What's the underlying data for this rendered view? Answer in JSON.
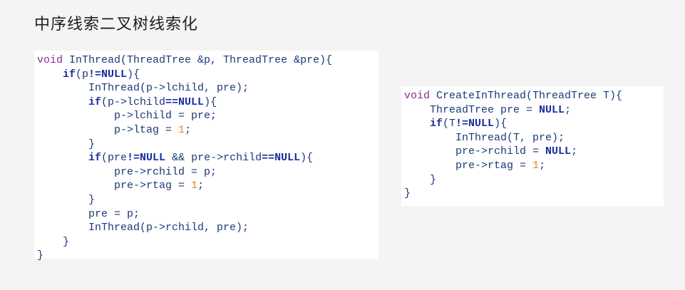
{
  "title": "中序线索二叉树线索化",
  "left_code": [
    {
      "indent": 0,
      "tokens": [
        {
          "t": "void",
          "c": "kw-void"
        },
        {
          "t": " InThread(ThreadTree &p, ThreadTree &pre){",
          "c": "plain"
        }
      ]
    },
    {
      "indent": 1,
      "tokens": [
        {
          "t": "if",
          "c": "kw-bold"
        },
        {
          "t": "(p",
          "c": "plain"
        },
        {
          "t": "!=NULL",
          "c": "kw-bold"
        },
        {
          "t": "){",
          "c": "plain"
        }
      ]
    },
    {
      "indent": 2,
      "tokens": [
        {
          "t": "InThread(p->lchild, pre);",
          "c": "plain"
        }
      ]
    },
    {
      "indent": 2,
      "tokens": [
        {
          "t": "if",
          "c": "kw-bold"
        },
        {
          "t": "(p->lchild",
          "c": "plain"
        },
        {
          "t": "==NULL",
          "c": "kw-bold"
        },
        {
          "t": "){",
          "c": "plain"
        }
      ]
    },
    {
      "indent": 3,
      "tokens": [
        {
          "t": "p->lchild = pre;",
          "c": "plain"
        }
      ]
    },
    {
      "indent": 3,
      "tokens": [
        {
          "t": "p->ltag = ",
          "c": "plain"
        },
        {
          "t": "1",
          "c": "num"
        },
        {
          "t": ";",
          "c": "plain"
        }
      ]
    },
    {
      "indent": 2,
      "tokens": [
        {
          "t": "}",
          "c": "plain"
        }
      ]
    },
    {
      "indent": 2,
      "tokens": [
        {
          "t": "if",
          "c": "kw-bold"
        },
        {
          "t": "(pre",
          "c": "plain"
        },
        {
          "t": "!=NULL",
          "c": "kw-bold"
        },
        {
          "t": " && pre->rchild",
          "c": "plain"
        },
        {
          "t": "==NULL",
          "c": "kw-bold"
        },
        {
          "t": "){",
          "c": "plain"
        }
      ]
    },
    {
      "indent": 3,
      "tokens": [
        {
          "t": "pre->rchild = p;",
          "c": "plain"
        }
      ]
    },
    {
      "indent": 3,
      "tokens": [
        {
          "t": "pre->rtag = ",
          "c": "plain"
        },
        {
          "t": "1",
          "c": "num"
        },
        {
          "t": ";",
          "c": "plain"
        }
      ]
    },
    {
      "indent": 2,
      "tokens": [
        {
          "t": "}",
          "c": "plain"
        }
      ]
    },
    {
      "indent": 2,
      "tokens": [
        {
          "t": "pre = p;",
          "c": "plain"
        }
      ]
    },
    {
      "indent": 2,
      "tokens": [
        {
          "t": "InThread(p->rchild, pre);",
          "c": "plain"
        }
      ]
    },
    {
      "indent": 1,
      "tokens": [
        {
          "t": "}",
          "c": "plain"
        }
      ]
    },
    {
      "indent": 0,
      "tokens": [
        {
          "t": "}",
          "c": "plain"
        }
      ]
    }
  ],
  "right_code": [
    {
      "indent": 0,
      "tokens": [
        {
          "t": "void",
          "c": "kw-void"
        },
        {
          "t": " CreateInThread(ThreadTree T){",
          "c": "plain"
        }
      ]
    },
    {
      "indent": 1,
      "tokens": [
        {
          "t": "ThreadTree pre = ",
          "c": "plain"
        },
        {
          "t": "NULL",
          "c": "kw-bold"
        },
        {
          "t": ";",
          "c": "plain"
        }
      ]
    },
    {
      "indent": 1,
      "tokens": [
        {
          "t": "if",
          "c": "kw-bold"
        },
        {
          "t": "(T",
          "c": "plain"
        },
        {
          "t": "!=NULL",
          "c": "kw-bold"
        },
        {
          "t": "){",
          "c": "plain"
        }
      ]
    },
    {
      "indent": 2,
      "tokens": [
        {
          "t": "InThread(T, pre);",
          "c": "plain"
        }
      ]
    },
    {
      "indent": 2,
      "tokens": [
        {
          "t": "pre->rchild = ",
          "c": "plain"
        },
        {
          "t": "NULL",
          "c": "kw-bold"
        },
        {
          "t": ";",
          "c": "plain"
        }
      ]
    },
    {
      "indent": 2,
      "tokens": [
        {
          "t": "pre->rtag = ",
          "c": "plain"
        },
        {
          "t": "1",
          "c": "num"
        },
        {
          "t": ";",
          "c": "plain"
        }
      ]
    },
    {
      "indent": 1,
      "tokens": [
        {
          "t": "}",
          "c": "plain"
        }
      ]
    },
    {
      "indent": 0,
      "tokens": [
        {
          "t": "}",
          "c": "plain"
        }
      ]
    }
  ]
}
